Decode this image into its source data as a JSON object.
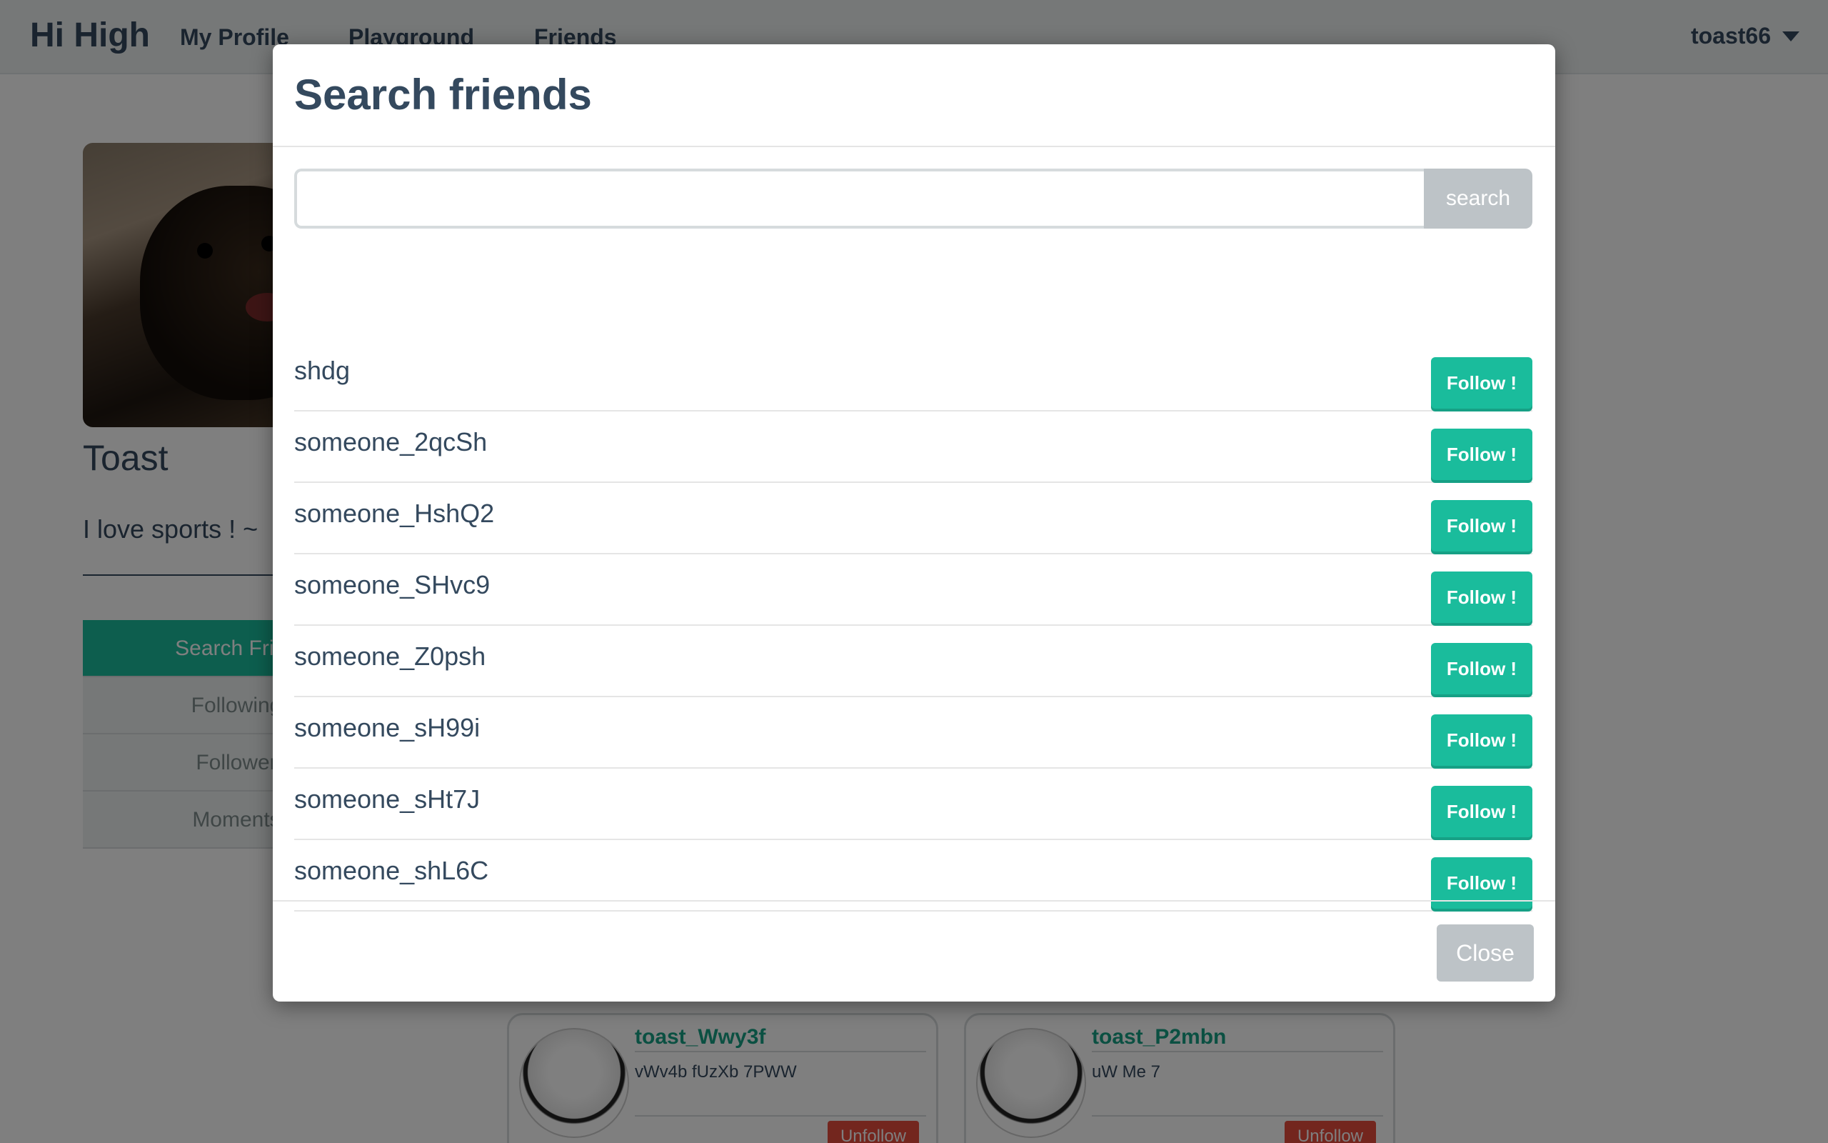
{
  "navbar": {
    "brand": "Hi High",
    "links": [
      "My Profile",
      "Playground",
      "Friends"
    ],
    "user": "toast66"
  },
  "profile": {
    "name": "Toast",
    "bio": "I love sports ! ~",
    "menu": [
      "Search Frien",
      "Following",
      "Follower",
      "Moments"
    ]
  },
  "friend_cards": [
    {
      "name": "toast_Wwy3f",
      "bio": "vWv4b fUzXb 7PWW",
      "action": "Unfollow"
    },
    {
      "name": "toast_P2mbn",
      "bio": "uW Me 7",
      "action": "Unfollow"
    }
  ],
  "modal": {
    "title": "Search friends",
    "search_value": "",
    "search_button": "search",
    "results": [
      {
        "name": "shdg",
        "action": "Follow !"
      },
      {
        "name": "someone_2qcSh",
        "action": "Follow !"
      },
      {
        "name": "someone_HshQ2",
        "action": "Follow !"
      },
      {
        "name": "someone_SHvc9",
        "action": "Follow !"
      },
      {
        "name": "someone_Z0psh",
        "action": "Follow !"
      },
      {
        "name": "someone_sH99i",
        "action": "Follow !"
      },
      {
        "name": "someone_sHt7J",
        "action": "Follow !"
      },
      {
        "name": "someone_shL6C",
        "action": "Follow !"
      }
    ],
    "close_button": "Close"
  },
  "colors": {
    "primary": "#1abc9c",
    "text": "#34495e",
    "danger": "#e74c3c",
    "muted": "#bdc3c7"
  }
}
